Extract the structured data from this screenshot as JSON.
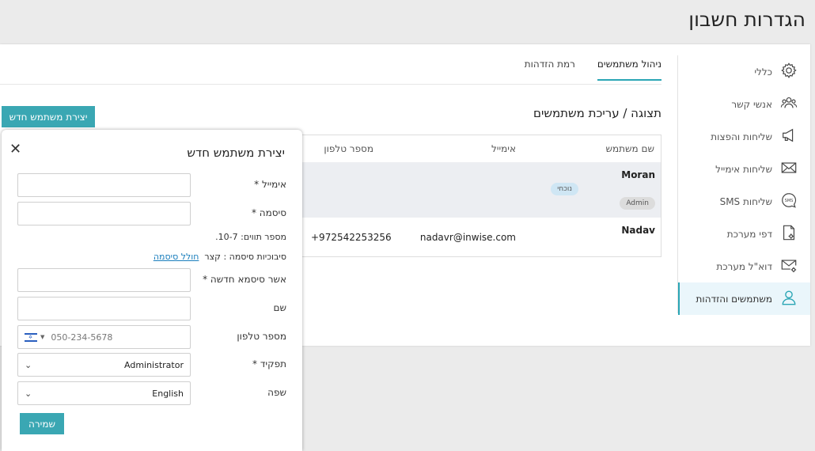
{
  "page": {
    "title": "הגדרות חשבון"
  },
  "sidebar": {
    "items": [
      {
        "label": "כללי",
        "icon": "gear-icon"
      },
      {
        "label": "אנשי קשר",
        "icon": "contacts-icon"
      },
      {
        "label": "שליחות והפצות",
        "icon": "megaphone-icon"
      },
      {
        "label": "שליחות אימייל",
        "icon": "envelope-icon"
      },
      {
        "label": "שליחות SMS",
        "icon": "sms-icon"
      },
      {
        "label": "דפי מערכת",
        "icon": "page-settings-icon"
      },
      {
        "label": "דוא\"ל מערכת",
        "icon": "mail-settings-icon"
      },
      {
        "label": "משתמשים והזדהות",
        "icon": "user-icon",
        "active": true
      }
    ]
  },
  "tabs": [
    {
      "label": "ניהול משתמשים",
      "active": true
    },
    {
      "label": "רמת הזדהות",
      "active": false
    }
  ],
  "section": {
    "title": "תצוגה / עריכת משתמשים"
  },
  "create_button": "יצירת משתמש חדש",
  "table": {
    "headers": {
      "username": "שם משתמש",
      "email": "אימייל",
      "phone": "מספר טלפון"
    },
    "rows": [
      {
        "username": "Moran",
        "email": "",
        "phone": "",
        "badges": [
          "נוכחי",
          "Admin"
        ]
      },
      {
        "username": "Nadav",
        "email": "nadavr@inwise.com",
        "phone": "+972542253256",
        "badges": []
      }
    ]
  },
  "modal": {
    "title": "יצירת משתמש חדש",
    "email_label": "אימייל *",
    "password_label": "סיסמה *",
    "password_length_hint": "מספר תווים: 10-7.",
    "password_complexity_hint": "סיבוכיות סיסמה : קצר",
    "generate_password_link": "חולל סיסמה",
    "confirm_label": "אשר סיסמא חדשה *",
    "name_label": "שם",
    "phone_label": "מספר טלפון",
    "phone_placeholder": "050-234-5678",
    "role_label": "תפקיד *",
    "role_value": "Administrator",
    "language_label": "שפה",
    "language_value": "English",
    "save_button": "שמירה"
  },
  "colors": {
    "accent": "#3aa7b3",
    "active_bg": "#eaf6fb",
    "link": "#1b7fbd"
  }
}
